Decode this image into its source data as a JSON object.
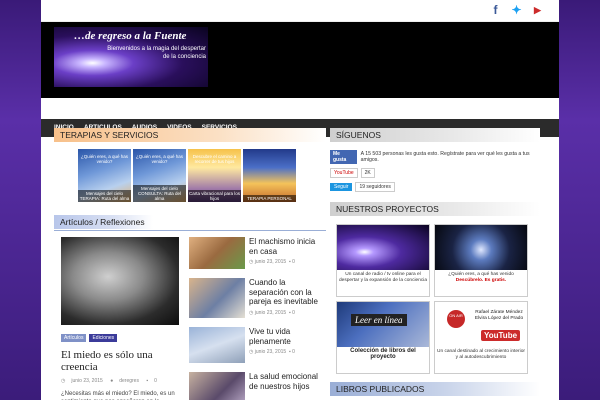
{
  "social": {
    "facebook": "f",
    "twitter": "t",
    "youtube": "You Tube"
  },
  "site": {
    "title": "…de regreso a la Fuente",
    "subtitle": "Bienvenidos a la magia del despertar de la conciencia"
  },
  "nav": [
    "INICIO",
    "ARTICULOS",
    "AUDIOS",
    "VIDEOS",
    "SERVICIOS"
  ],
  "terapias": {
    "title": "TERAPIAS Y SERVICIOS",
    "cards": [
      {
        "top": "¿Quién eres, a qué has venido?",
        "caption": "Mensajes del cielo TERAPIA: Ruta del alma"
      },
      {
        "top": "¿Quién eres, a qué has venido?",
        "caption": "Mensajes del cielo CONSULTA: Ruta del alma"
      },
      {
        "top": "Descubre el camino a recorrer de tus hijos",
        "caption": "Carta vibracional para los hijos"
      },
      {
        "top": "",
        "caption": "TERAPIA PERSONAL"
      }
    ]
  },
  "articulos": {
    "title": "Artículos / Reflexiones",
    "featured": {
      "tags": [
        "Artículos",
        "Ediciones"
      ],
      "title": "El miedo es sólo una creencia",
      "date": "junio 23, 2015",
      "author": "deregres",
      "comments": "0",
      "excerpt": "¿Necesitas más el miedo? El miedo, es un sentimiento que nos enseñaron en la"
    },
    "list": [
      {
        "title": "El machismo inicia en casa",
        "date": "junio 23, 2015",
        "comments": "0"
      },
      {
        "title": "Cuando la separación con la pareja es inevitable",
        "date": "junio 23, 2015",
        "comments": "0"
      },
      {
        "title": "Vive tu vida plenamente",
        "date": "junio 23, 2015",
        "comments": "0"
      },
      {
        "title": "La salud emocional de nuestros hijos",
        "date": "",
        "comments": ""
      }
    ]
  },
  "siguenos": {
    "title": "SÍGUENOS",
    "fb_button": "Me gusta",
    "fb_text": "A 15 503 personas les gusta esto. Regístrate para ver qué les gusta a tus amigos.",
    "yt_button": "YouTube",
    "yt_count": "2K",
    "tw_button": "Seguir",
    "tw_count": "19 seguidores"
  },
  "proyectos": {
    "title": "NUESTROS PROYECTOS",
    "items": [
      {
        "caption": "Un canal de radio / tv online para el despertar y la expansión de la conciencia"
      },
      {
        "caption": "¿Quién eres, a qué has venido",
        "highlight": "Descúbrelo. Es gratis."
      },
      {
        "label": "Leer en línea",
        "caption": "Colección de libros del proyecto"
      },
      {
        "badge": "ON AIR",
        "text": "Rafael Zárate Méndez Elvira López del Prado",
        "yt": "YouTube",
        "caption": "Un canal destinado al crecimiento interior y al autodescubrimiento"
      }
    ]
  },
  "libros": {
    "title": "LIBROS PUBLICADOS"
  }
}
